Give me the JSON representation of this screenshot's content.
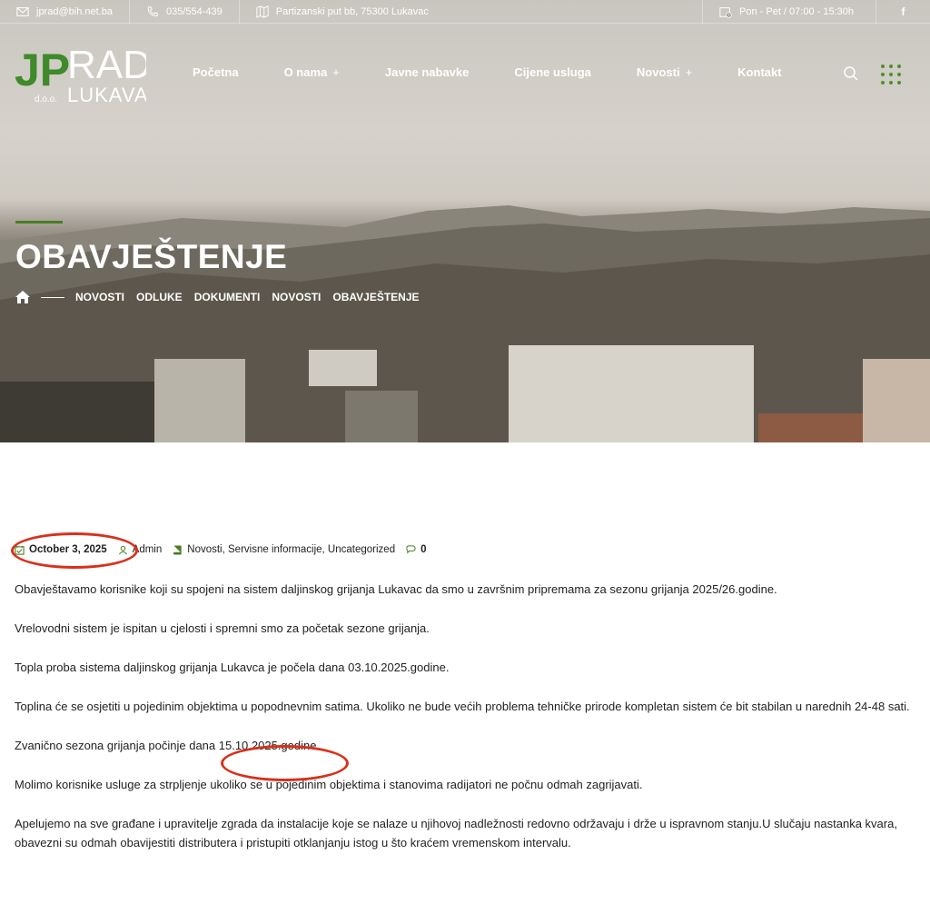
{
  "topbar": {
    "email": "jprad@bih.net.ba",
    "phone": "035/554-439",
    "address": "Partizanski put bb, 75300 Lukavac",
    "hours": "Pon - Pet / 07:00 - 15:30h",
    "facebook_icon": "f"
  },
  "logo": {
    "jp": "JP",
    "rad": "RAD",
    "doo": "d.o.o.",
    "city": "LUKAVAC"
  },
  "nav": {
    "items": [
      {
        "label": "Početna",
        "plus": ""
      },
      {
        "label": "O nama",
        "plus": "+"
      },
      {
        "label": "Javne nabavke",
        "plus": ""
      },
      {
        "label": "Cijene usluga",
        "plus": ""
      },
      {
        "label": "Novosti",
        "plus": "+"
      },
      {
        "label": "Kontakt",
        "plus": ""
      }
    ]
  },
  "page": {
    "title": "OBAVJEŠTENJE",
    "breadcrumb": [
      "NOVOSTI",
      "ODLUKE",
      "DOKUMENTI",
      "NOVOSTI",
      "OBAVJEŠTENJE"
    ]
  },
  "meta": {
    "date": "October 3, 2025",
    "author": "Admin",
    "categories": "Novosti, Servisne informacije, Uncategorized",
    "comments": "0"
  },
  "article": {
    "paragraphs": [
      "Obavještavamo korisnike koji su spojeni na sistem daljinskog grijanja Lukavac da smo u završnim pripremama za sezonu grijanja 2025/26.godine.",
      "Vrelovodni sistem je ispitan u cjelosti i spremni smo za početak sezone grijanja.",
      "Topla proba sistema daljinskog grijanja Lukavca je počela dana 03.10.2025.godine.",
      "Toplina će se osjetiti u pojedinim objektima u popodnevnim satima. Ukoliko ne bude većih problema tehničke prirode kompletan sistem će bit stabilan u narednih 24-48 sati.",
      "Zvanično sezona grijanja počinje dana 15.10.2025.godine.",
      "Molimo korisnike usluge za strpljenje ukoliko se u pojedinim objektima i stanovima radijatori ne počnu odmah zagrijavati.",
      "Apelujemo na sve građane i upravitelje zgrada da instalacije koje se nalaze u njihovoj nadležnosti redovno održavaju i drže u ispravnom stanju.U slučaju nastanka kvara, obavezni su odmah obavijestiti distributera i pristupiti otklanjanju istog u što kraćem vremenskom intervalu."
    ]
  },
  "colors": {
    "accent": "#4a7d24",
    "highlight": "#d8301c"
  }
}
